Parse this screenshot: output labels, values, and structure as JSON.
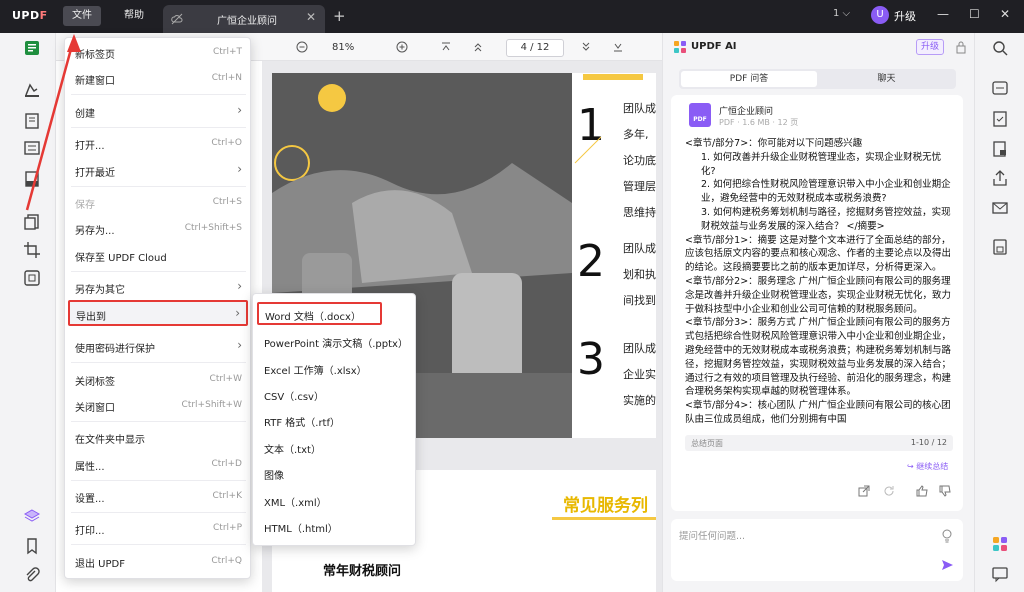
{
  "titlebar": {
    "logo_u": "UPD",
    "logo_f": "F",
    "menu_file": "文件",
    "menu_help": "帮助",
    "tab_title": "广恒企业顾问",
    "tab_close": "✕",
    "tab_add": "+",
    "account_count": "1 ⌵",
    "upgrade_avatar": "U",
    "upgrade_label": "升级",
    "minimize": "—",
    "maximize": "☐",
    "close": "✕"
  },
  "toolbar": {
    "zoom": "81%",
    "page_current": "4",
    "page_total": "12",
    "page_display": "4  /  12"
  },
  "file_menu": {
    "items": [
      {
        "label": "新标签页",
        "shortcut": "Ctrl+T"
      },
      {
        "label": "新建窗口",
        "shortcut": "Ctrl+N"
      },
      {
        "label": "创建",
        "shortcut": ""
      },
      {
        "label": "打开...",
        "shortcut": "Ctrl+O"
      },
      {
        "label": "打开最近",
        "shortcut": ""
      },
      {
        "label": "保存",
        "shortcut": "Ctrl+S"
      },
      {
        "label": "另存为...",
        "shortcut": "Ctrl+Shift+S"
      },
      {
        "label": "保存至 UPDF Cloud",
        "shortcut": ""
      },
      {
        "label": "另存为其它",
        "shortcut": ""
      },
      {
        "label": "导出到",
        "shortcut": ""
      },
      {
        "label": "使用密码进行保护",
        "shortcut": ""
      },
      {
        "label": "关闭标签",
        "shortcut": "Ctrl+W"
      },
      {
        "label": "关闭窗口",
        "shortcut": "Ctrl+Shift+W"
      },
      {
        "label": "在文件夹中显示",
        "shortcut": ""
      },
      {
        "label": "属性...",
        "shortcut": "Ctrl+D"
      },
      {
        "label": "设置...",
        "shortcut": "Ctrl+K"
      },
      {
        "label": "打印...",
        "shortcut": "Ctrl+P"
      },
      {
        "label": "退出 UPDF",
        "shortcut": "Ctrl+Q"
      }
    ]
  },
  "export_menu": {
    "items": [
      "Word 文档（.docx）",
      "PowerPoint 演示文稿（.pptx）",
      "Excel 工作簿（.xlsx）",
      "CSV（.csv）",
      "RTF 格式（.rtf）",
      "文本（.txt）",
      "图像",
      "XML（.xml）",
      "HTML（.html）"
    ]
  },
  "document": {
    "num1": "1",
    "num2": "2",
    "num3": "3",
    "t1": [
      "团队成",
      "多年,",
      "论功底",
      "管理层",
      "思维持"
    ],
    "t2": [
      "团队成",
      "划和执",
      "间找到"
    ],
    "t3": [
      "团队成",
      "企业实",
      "实施的"
    ],
    "section_title": "常见服务列",
    "sub_title": "常年财税顾问"
  },
  "ai_panel": {
    "title": "UPDF AI",
    "upgrade": "升级",
    "tab_pdf": "PDF 问答",
    "tab_chat": "聊天",
    "file_name": "广恒企业顾问",
    "file_icon_text": "PDF",
    "file_meta": "PDF · 1.6 MB · 12 页",
    "answer": [
      {
        "text": "<章节/部分7>：你可能对以下问题感兴趣",
        "ind": false
      },
      {
        "text": "1. 如何改善并升级企业财税管理业态，实现企业财税无忧化?",
        "ind": true
      },
      {
        "text": "2. 如何把综合性财税风险管理意识带入中小企业和创业期企业，避免经营中的无效财税成本或税务浪费?",
        "ind": true
      },
      {
        "text": "3. 如何构建税务筹划机制与路径，挖掘财务管控效益，实现财税效益与业务发展的深入结合？ </摘要>",
        "ind": true
      },
      {
        "text": "<章节/部分1>：摘要 这是对整个文本进行了全面总结的部分，应该包括原文内容的要点和核心观念、作者的主要论点以及得出的结论。这段摘要要比之前的版本更加详尽，分析得更深入。",
        "ind": false
      },
      {
        "text": "<章节/部分2>：服务理念 广州广恒企业顾问有限公司的服务理念是改善并升级企业财税管理业态，实现企业财税无忧化，致力于做科技型中小企业和创业公司可信赖的财税服务顾问。",
        "ind": false
      },
      {
        "text": "<章节/部分3>：服务方式 广州广恒企业顾问有限公司的服务方式包括把综合性财税风险管理意识带入中小企业和创业期企业，避免经营中的无效财税成本或税务浪费；构建税务筹划机制与路径，挖掘财务管控效益，实现财税效益与业务发展的深入结合；通过行之有效的项目管理及执行经验、前沿化的服务理念，构建合理税务架构实现卓越的财税管理体系。",
        "ind": false
      },
      {
        "text": "<章节/部分4>：核心团队 广州广恒企业顾问有限公司的核心团队由三位成员组成，他们分别拥有中国",
        "ind": false
      }
    ],
    "footer_left": "总结页面",
    "footer_right": "1-10 / 12",
    "continue_link": "↪ 继续总结",
    "input_placeholder": "提问任何问题..."
  },
  "colors": {
    "accent": "#8a5cf5",
    "highlight_red": "#e53935",
    "doc_yellow": "#f5c842"
  }
}
